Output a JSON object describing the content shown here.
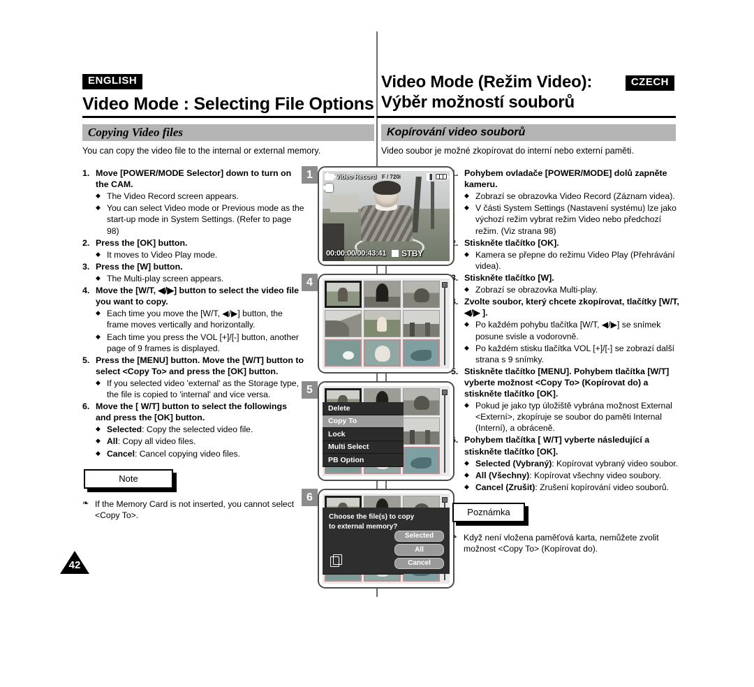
{
  "page": {
    "number": "42",
    "left_lang_tag": "ENGLISH",
    "right_lang_tag": "CZECH"
  },
  "header": {
    "en_title": "Video Mode : Selecting File Options",
    "cz_title_line1": "Video Mode (Režim Video):",
    "cz_title_line2": "Výběr možností souborů"
  },
  "section": {
    "en_title": "Copying Video files",
    "cz_title": "Kopírování video souborů",
    "en_intro": "You can copy the video file to the internal or external memory.",
    "cz_intro": "Video soubor je možné zkopírovat do interní nebo externí paměti."
  },
  "english_steps": [
    {
      "num": "1.",
      "title": "Move [POWER/MODE Selector] down to turn on the CAM.",
      "bullets": [
        "The Video Record screen appears.",
        "You can select Video mode or Previous mode as the start-up mode in System Settings. (Refer to page 98)"
      ]
    },
    {
      "num": "2.",
      "title": "Press the [OK] button.",
      "bullets": [
        "It moves to Video Play mode."
      ]
    },
    {
      "num": "3.",
      "title": "Press the [W] button.",
      "bullets": [
        "The Multi-play screen appears."
      ]
    },
    {
      "num": "4.",
      "title": "Move the [W/T, ◀/▶] button to select the video file you want to copy.",
      "bullets": [
        "Each time you move the [W/T, ◀/▶] button, the frame moves vertically and horizontally.",
        "Each time you press the VOL [+]/[-] button, another page of 9 frames is displayed."
      ]
    },
    {
      "num": "5.",
      "title": "Press the [MENU] button. Move the [W/T] button to select <Copy To> and press the [OK] button.",
      "bullets": [
        "If you selected video 'external' as the Storage type, the file is copied to 'internal' and vice versa."
      ]
    },
    {
      "num": "6.",
      "title": "Move the [ W/T] button to select the followings and press the [OK] button.",
      "bullets": [
        "Selected: Copy the selected video file.",
        "All: Copy all video files.",
        "Cancel: Cancel copying video files."
      ],
      "bold_leads": [
        "Selected",
        "All",
        "Cancel"
      ]
    }
  ],
  "czech_steps": [
    {
      "num": "1.",
      "title": "Pohybem ovladače [POWER/MODE] dolů zapněte kameru.",
      "bullets": [
        "Zobrazí se obrazovka Video Record (Záznam videa).",
        "V části System Settings (Nastavení systému) lze jako výchozí režim vybrat režim Video nebo předchozí režim. (Viz strana 98)"
      ]
    },
    {
      "num": "2.",
      "title": "Stiskněte tlačítko [OK].",
      "bullets": [
        "Kamera se přepne do režimu Video Play (Přehrávání videa)."
      ]
    },
    {
      "num": "3.",
      "title": "Stiskněte tlačítko [W].",
      "bullets": [
        "Zobrazí se obrazovka Multi-play."
      ]
    },
    {
      "num": "4.",
      "title": "Zvolte soubor, který chcete zkopírovat, tlačítky [W/T, ◀/▶ ].",
      "bullets": [
        "Po každém pohybu tlačítka [W/T, ◀/▶] se snímek posune svisle a vodorovně.",
        "Po každém stisku tlačítka VOL [+]/[-] se zobrazí další strana s 9 snímky."
      ]
    },
    {
      "num": "5.",
      "title": "Stiskněte tlačítko [MENU]. Pohybem tlačítka [W/T] vyberte možnost <Copy To> (Kopírovat do) a stiskněte tlačítko [OK].",
      "bullets": [
        "Pokud je jako typ úložiště vybrána možnost External <Externí>, zkopíruje se soubor do paměti Internal (Interní), a obráceně."
      ]
    },
    {
      "num": "6.",
      "title": "Pohybem tlačítka [ W/T] vyberte následující a stiskněte tlačítko [OK].",
      "bullets": [
        "Selected (Vybraný): Kopírovat vybraný video soubor.",
        "All (Všechny): Kopírovat všechny video soubory.",
        "Cancel (Zrušit): Zrušení kopírování video souborů."
      ],
      "bold_leads": [
        "Selected (Vybraný)",
        "All (Všechny)",
        "Cancel (Zrušit)"
      ]
    }
  ],
  "notes": {
    "en_label": "Note",
    "en_text": "If the Memory Card is not inserted, you cannot select <Copy To>.",
    "cz_label": "Poznámka",
    "cz_text": "Když není vložena paměťová karta, nemůžete zvolit možnost <Copy To> (Kopírovat do)."
  },
  "screens": {
    "badges": [
      "1",
      "4",
      "5",
      "6"
    ],
    "video_record": {
      "mode_label": "Video Record",
      "quality_label": "F / 720i",
      "timecode": "00:00:00/00:43:41",
      "status_label": "STBY"
    },
    "menu": {
      "items": [
        "Delete",
        "Copy To",
        "Lock",
        "Multi Select",
        "PB Option"
      ],
      "highlighted": "Copy To"
    },
    "dialog": {
      "message_line1": "Choose the file(s) to copy",
      "message_line2": "to external memory?",
      "buttons": [
        "Selected",
        "All",
        "Cancel"
      ]
    }
  }
}
